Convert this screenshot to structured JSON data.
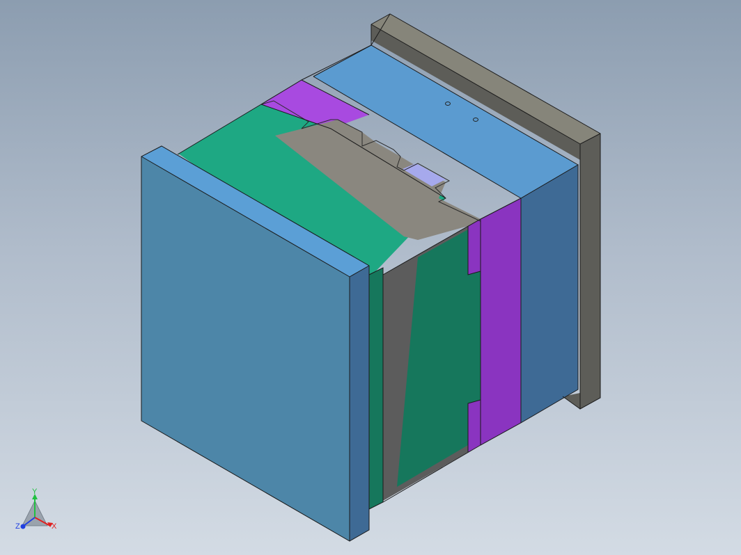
{
  "colors": {
    "background_top": "#8c9db0",
    "background_bottom": "#d3dbe4",
    "front_clamp_plate": "#4d86a8",
    "front_clamp_plate_edge": "#5b9fd6",
    "front_clamp_plate_side": "#3e6a95",
    "cavity_plate_top": "#1ea883",
    "cavity_plate_side": "#16775c",
    "ejector_plate": "#5c5c5c",
    "core_insert_top": "#8a877f",
    "slider": "#a84ae0",
    "slider_side": "#8a34c0",
    "core_plate_top": "#5b9bd0",
    "core_plate_side": "#3e6a95",
    "rear_clamp_plate_top": "#86857a",
    "rear_clamp_plate_side": "#5d5d58",
    "gate_insert": "#a6a9ec"
  },
  "triad": {
    "x_label": "X",
    "y_label": "Y",
    "z_label": "Z",
    "x_color": "#e02020",
    "y_color": "#20c040",
    "z_color": "#2040e0"
  }
}
